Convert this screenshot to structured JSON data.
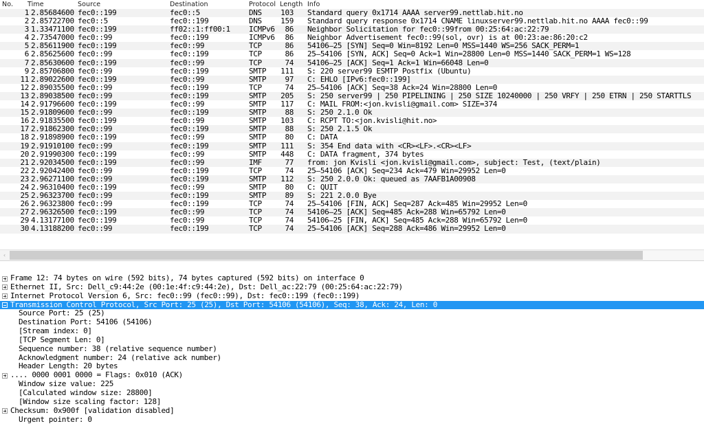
{
  "packet_list": {
    "columns": [
      "No.",
      "Time",
      "Source",
      "Destination",
      "Protocol",
      "Length",
      "Info"
    ],
    "rows": [
      {
        "no": "1",
        "time": "2.85684600",
        "src": "fec0::199",
        "dst": "fec0::5",
        "proto": "DNS",
        "len": "103",
        "info": "Standard query 0x1714   AAAA server99.nettlab.hit.no"
      },
      {
        "no": "2",
        "time": "2.85722700",
        "src": "fec0::5",
        "dst": "fec0::199",
        "proto": "DNS",
        "len": "159",
        "info": "Standard query response 0x1714   CNAME linuxserver99.nettlab.hit.no AAAA fec0::99"
      },
      {
        "no": "3",
        "time": "1.33471100",
        "src": "fec0::199",
        "dst": "ff02::1:ff00:1",
        "proto": "ICMPv6",
        "len": "86",
        "info": "Neighbor Solicitation for fec0::99from 00:25:64:ac:22:79"
      },
      {
        "no": "4",
        "time": "2.73547000",
        "src": "fec0::99",
        "dst": "fec0::199",
        "proto": "ICMPv6",
        "len": "86",
        "info": "Neighbor Advertisement fec0::99(sol, ovr) is at 00:23:ae:86:20:c2"
      },
      {
        "no": "5",
        "time": "2.85611900",
        "src": "fec0::199",
        "dst": "fec0::99",
        "proto": "TCP",
        "len": "86",
        "info": "54106–25 [SYN] Seq=0 Win=8192 Len=0 MSS=1440 WS=256 SACK_PERM=1"
      },
      {
        "no": "6",
        "time": "2.85625600",
        "src": "fec0::99",
        "dst": "fec0::199",
        "proto": "TCP",
        "len": "86",
        "info": "25–54106 [SYN, ACK] Seq=0 Ack=1 Win=28800 Len=0 MSS=1440 SACK_PERM=1 WS=128"
      },
      {
        "no": "7",
        "time": "2.85630600",
        "src": "fec0::199",
        "dst": "fec0::99",
        "proto": "TCP",
        "len": "74",
        "info": "54106–25 [ACK] Seq=1 Ack=1 Win=66048 Len=0"
      },
      {
        "no": "9",
        "time": "2.85706800",
        "src": "fec0::99",
        "dst": "fec0::199",
        "proto": "SMTP",
        "len": "111",
        "info": "S: 220 server99 ESMTP Postfix (Ubuntu)"
      },
      {
        "no": "11",
        "time": "2.89022600",
        "src": "fec0::199",
        "dst": "fec0::99",
        "proto": "SMTP",
        "len": "97",
        "info": "C: EHLO [IPv6:fec0::199]"
      },
      {
        "no": "12",
        "time": "2.89035500",
        "src": "fec0::99",
        "dst": "fec0::199",
        "proto": "TCP",
        "len": "74",
        "info": "25–54106 [ACK] Seq=38 Ack=24 Win=28800 Len=0"
      },
      {
        "no": "13",
        "time": "2.89038500",
        "src": "fec0::99",
        "dst": "fec0::199",
        "proto": "SMTP",
        "len": "205",
        "info": "S: 250 server99 | 250 PIPELINING | 250 SIZE 10240000 | 250 VRFY | 250 ETRN | 250 STARTTLS"
      },
      {
        "no": "14",
        "time": "2.91796600",
        "src": "fec0::199",
        "dst": "fec0::99",
        "proto": "SMTP",
        "len": "117",
        "info": "C: MAIL FROM:<jon.kvisli@gmail.com> SIZE=374"
      },
      {
        "no": "15",
        "time": "2.91809600",
        "src": "fec0::99",
        "dst": "fec0::199",
        "proto": "SMTP",
        "len": "88",
        "info": "S: 250 2.1.0 Ok"
      },
      {
        "no": "16",
        "time": "2.91835500",
        "src": "fec0::199",
        "dst": "fec0::99",
        "proto": "SMTP",
        "len": "103",
        "info": "C: RCPT TO:<jon.kvisli@hit.no>"
      },
      {
        "no": "17",
        "time": "2.91862300",
        "src": "fec0::99",
        "dst": "fec0::199",
        "proto": "SMTP",
        "len": "88",
        "info": "S: 250 2.1.5 Ok"
      },
      {
        "no": "18",
        "time": "2.91898900",
        "src": "fec0::199",
        "dst": "fec0::99",
        "proto": "SMTP",
        "len": "80",
        "info": "C: DATA"
      },
      {
        "no": "19",
        "time": "2.91910100",
        "src": "fec0::99",
        "dst": "fec0::199",
        "proto": "SMTP",
        "len": "111",
        "info": "S: 354 End data with <CR><LF>.<CR><LF>"
      },
      {
        "no": "20",
        "time": "2.91990300",
        "src": "fec0::199",
        "dst": "fec0::99",
        "proto": "SMTP",
        "len": "448",
        "info": "C: DATA fragment, 374 bytes"
      },
      {
        "no": "21",
        "time": "2.92034500",
        "src": "fec0::199",
        "dst": "fec0::99",
        "proto": "IMF",
        "len": "77",
        "info": "from: jon Kvisli <jon.kvisli@gmail.com>, subject: Test,  (text/plain)"
      },
      {
        "no": "22",
        "time": "2.92042400",
        "src": "fec0::99",
        "dst": "fec0::199",
        "proto": "TCP",
        "len": "74",
        "info": "25–54106 [ACK] Seq=234 Ack=479 Win=29952 Len=0"
      },
      {
        "no": "23",
        "time": "2.96271100",
        "src": "fec0::99",
        "dst": "fec0::199",
        "proto": "SMTP",
        "len": "112",
        "info": "S: 250 2.0.0 Ok: queued as 7AAFB1A00908"
      },
      {
        "no": "24",
        "time": "2.96310400",
        "src": "fec0::199",
        "dst": "fec0::99",
        "proto": "SMTP",
        "len": "80",
        "info": "C: QUIT"
      },
      {
        "no": "25",
        "time": "2.96323700",
        "src": "fec0::99",
        "dst": "fec0::199",
        "proto": "SMTP",
        "len": "89",
        "info": "S: 221 2.0.0 Bye"
      },
      {
        "no": "26",
        "time": "2.96323800",
        "src": "fec0::99",
        "dst": "fec0::199",
        "proto": "TCP",
        "len": "74",
        "info": "25–54106 [FIN, ACK] Seq=287 Ack=485 Win=29952 Len=0"
      },
      {
        "no": "27",
        "time": "2.96326500",
        "src": "fec0::199",
        "dst": "fec0::99",
        "proto": "TCP",
        "len": "74",
        "info": "54106–25 [ACK] Seq=485 Ack=288 Win=65792 Len=0"
      },
      {
        "no": "29",
        "time": "4.13177100",
        "src": "fec0::199",
        "dst": "fec0::99",
        "proto": "TCP",
        "len": "74",
        "info": "54106–25 [FIN, ACK] Seq=485 Ack=288 Win=65792 Len=0"
      },
      {
        "no": "30",
        "time": "4.13188200",
        "src": "fec0::99",
        "dst": "fec0::199",
        "proto": "TCP",
        "len": "74",
        "info": "25–54106 [ACK] Seq=288 Ack=486 Win=29952 Len=0"
      }
    ]
  },
  "scrollbar": {
    "left_arrow": "‹"
  },
  "packet_detail": {
    "rows": [
      {
        "text": "Frame 12: 74 bytes on wire (592 bits), 74 bytes captured (592 bits) on interface 0",
        "expander": "plus",
        "indent": 0,
        "selected": false
      },
      {
        "text": "Ethernet II, Src: Dell_c9:44:2e (00:1e:4f:c9:44:2e), Dst: Dell_ac:22:79 (00:25:64:ac:22:79)",
        "expander": "plus",
        "indent": 0,
        "selected": false
      },
      {
        "text": "Internet Protocol Version 6, Src: fec0::99 (fec0::99), Dst: fec0::199 (fec0::199)",
        "expander": "plus",
        "indent": 0,
        "selected": false
      },
      {
        "text": "Transmission Control Protocol, Src Port: 25 (25), Dst Port: 54106 (54106), Seq: 38, Ack: 24, Len: 0",
        "expander": "minus",
        "indent": 0,
        "selected": true
      },
      {
        "text": "Source Port: 25 (25)",
        "expander": "none",
        "indent": 1,
        "selected": false
      },
      {
        "text": "Destination Port: 54106 (54106)",
        "expander": "none",
        "indent": 1,
        "selected": false
      },
      {
        "text": "[Stream index: 0]",
        "expander": "none",
        "indent": 1,
        "selected": false
      },
      {
        "text": "[TCP Segment Len: 0]",
        "expander": "none",
        "indent": 1,
        "selected": false
      },
      {
        "text": "Sequence number: 38    (relative sequence number)",
        "expander": "none",
        "indent": 1,
        "selected": false
      },
      {
        "text": "Acknowledgment number: 24    (relative ack number)",
        "expander": "none",
        "indent": 1,
        "selected": false
      },
      {
        "text": "Header Length: 20 bytes",
        "expander": "none",
        "indent": 1,
        "selected": false
      },
      {
        "text": ".... 0000 0001 0000 = Flags: 0x010 (ACK)",
        "expander": "plus",
        "indent": 0,
        "selected": false
      },
      {
        "text": "Window size value: 225",
        "expander": "none",
        "indent": 1,
        "selected": false
      },
      {
        "text": "[Calculated window size: 28800]",
        "expander": "none",
        "indent": 1,
        "selected": false
      },
      {
        "text": "[Window size scaling factor: 128]",
        "expander": "none",
        "indent": 1,
        "selected": false
      },
      {
        "text": "Checksum: 0x900f [validation disabled]",
        "expander": "plus",
        "indent": 0,
        "selected": false
      },
      {
        "text": "Urgent pointer: 0",
        "expander": "none",
        "indent": 1,
        "selected": false
      }
    ]
  },
  "colors": {
    "selection_blue": "#2196f3",
    "alt_row": "#f2f2f2",
    "scrollbar_thumb": "#cdcdcd"
  }
}
